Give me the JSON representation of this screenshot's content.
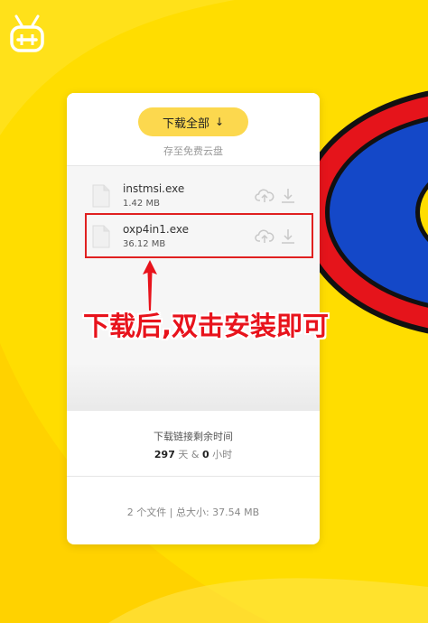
{
  "card": {
    "download_all_label": "下载全部",
    "download_all_arrow": "↓",
    "save_to_cloud": "存至免费云盘"
  },
  "files": [
    {
      "name": "instmsi.exe",
      "size": "1.42 MB",
      "icon": "file-icon"
    },
    {
      "name": "oxp4in1.exe",
      "size": "36.12 MB",
      "icon": "file-icon"
    }
  ],
  "remaining": {
    "title": "下载链接剩余时间",
    "days": "297",
    "days_unit": "天 &",
    "hours": "0",
    "hours_unit": "小时"
  },
  "summary": "2 个文件 | 总大小: 37.54 MB",
  "annotation": {
    "text": "下载后,双击安装即可",
    "color": "#E8131C"
  },
  "colors": {
    "background": "#FFDD00",
    "accent_button": "#FCD84E"
  },
  "icons": {
    "cloud": "cloud-upload-icon",
    "download": "download-icon",
    "logo": "mascot-logo"
  }
}
